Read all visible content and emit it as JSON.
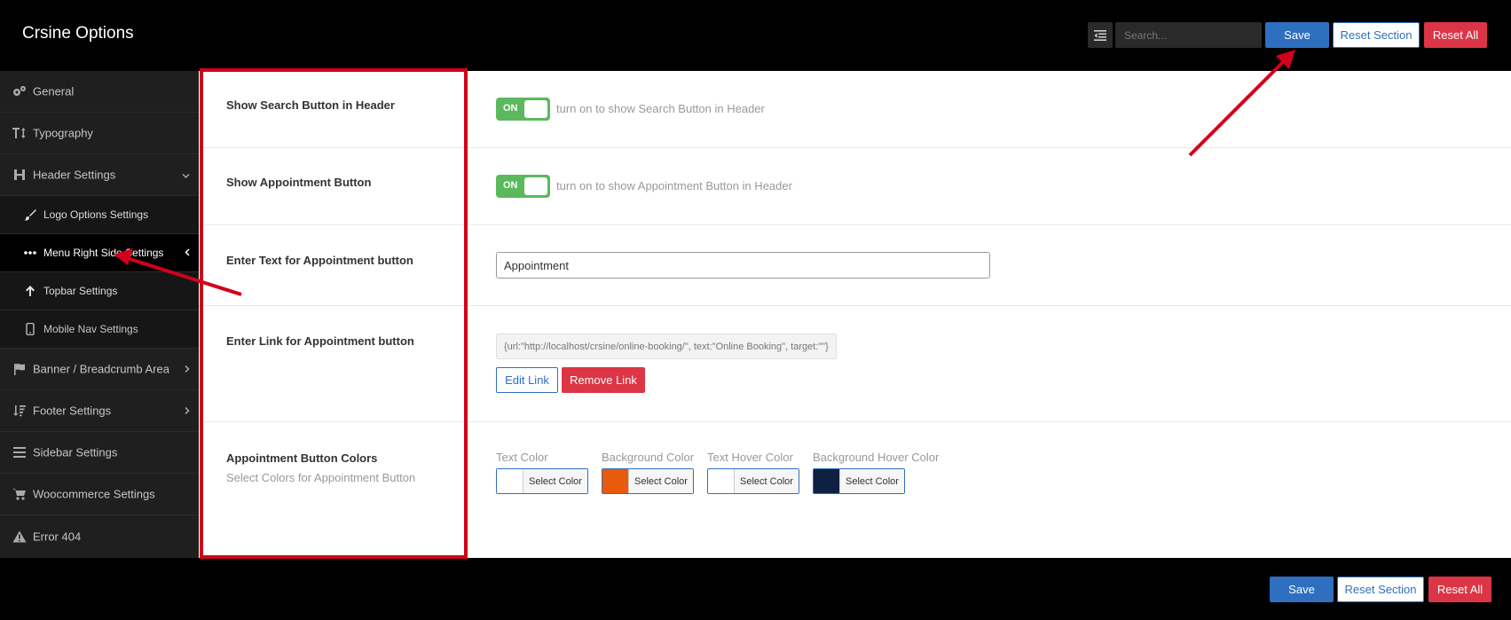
{
  "header": {
    "title": "Crsine Options",
    "search_placeholder": "Search...",
    "save_label": "Save",
    "reset_section_label": "Reset Section",
    "reset_all_label": "Reset All"
  },
  "sidebar": {
    "items": [
      {
        "label": "General",
        "icon": "gears-icon"
      },
      {
        "label": "Typography",
        "icon": "text-height-icon"
      },
      {
        "label": "Header Settings",
        "icon": "header-icon"
      },
      {
        "label": "Logo Options Settings",
        "icon": "brush-icon"
      },
      {
        "label": "Menu Right Side Settings",
        "icon": "ellipsis-icon"
      },
      {
        "label": "Topbar Settings",
        "icon": "arrow-up-icon"
      },
      {
        "label": "Mobile Nav Settings",
        "icon": "mobile-icon"
      },
      {
        "label": "Banner / Breadcrumb Area",
        "icon": "flag-icon"
      },
      {
        "label": "Footer Settings",
        "icon": "sort-icon"
      },
      {
        "label": "Sidebar Settings",
        "icon": "bars-icon"
      },
      {
        "label": "Woocommerce Settings",
        "icon": "cart-icon"
      },
      {
        "label": "Error 404",
        "icon": "warning-icon"
      }
    ]
  },
  "settings": {
    "search_button": {
      "label": "Show Search Button in Header",
      "toggle": "ON",
      "desc": "turn on to show Search Button in Header"
    },
    "appointment_button": {
      "label": "Show Appointment Button",
      "toggle": "ON",
      "desc": "turn on to show Appointment Button in Header"
    },
    "appointment_text": {
      "label": "Enter Text for Appointment button",
      "value": "Appointment"
    },
    "appointment_link": {
      "label": "Enter Link for Appointment button",
      "value": "{url:\"http://localhost/crsine/online-booking/\", text:\"Online Booking\", target:\"\"}",
      "edit_label": "Edit Link",
      "remove_label": "Remove Link"
    },
    "appointment_colors": {
      "label": "Appointment Button Colors",
      "desc": "Select Colors for Appointment Button",
      "pickers": [
        {
          "label": "Text Color",
          "button": "Select Color",
          "color": "#ffffff"
        },
        {
          "label": "Background Color",
          "button": "Select Color",
          "color": "#e85a0c"
        },
        {
          "label": "Text Hover Color",
          "button": "Select Color",
          "color": "#ffffff"
        },
        {
          "label": "Background Hover Color",
          "button": "Select Color",
          "color": "#0f2142"
        }
      ]
    }
  },
  "footer": {
    "save_label": "Save",
    "reset_section_label": "Reset Section",
    "reset_all_label": "Reset All"
  }
}
